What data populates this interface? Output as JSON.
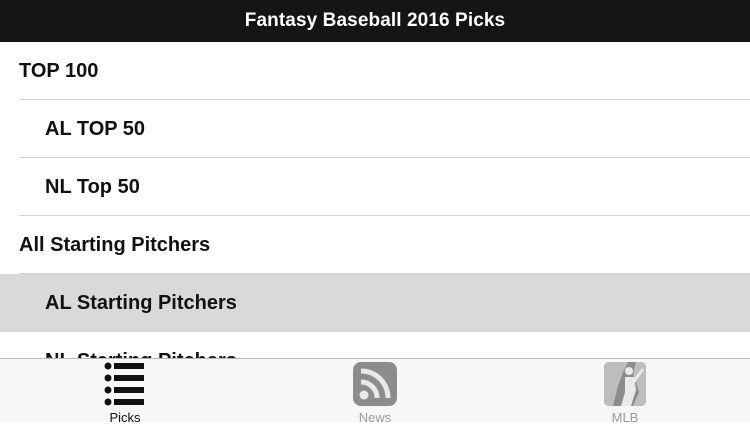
{
  "nav": {
    "title": "Fantasy Baseball 2016 Picks"
  },
  "list": {
    "items": [
      {
        "label": "TOP 100"
      },
      {
        "label": "AL TOP 50"
      },
      {
        "label": "NL Top 50"
      },
      {
        "label": "All Starting Pitchers"
      },
      {
        "label": "AL Starting Pitchers"
      },
      {
        "label": "NL Starting Pitchers"
      }
    ]
  },
  "tabs": [
    {
      "label": "Picks",
      "icon": "list-icon"
    },
    {
      "label": "News",
      "icon": "rss-icon"
    },
    {
      "label": "MLB",
      "icon": "mlb-logo-icon"
    }
  ],
  "colors": {
    "nav_background": "#151515",
    "selected_row": "#d9d9d9",
    "active_tab": "#111111",
    "inactive_tab": "#9a9a9a"
  }
}
